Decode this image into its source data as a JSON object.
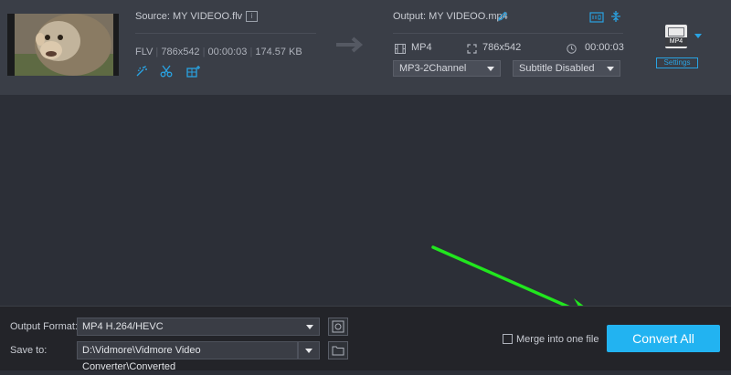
{
  "source": {
    "label": "Source: MY VIDEOO.flv",
    "format": "FLV",
    "resolution": "786x542",
    "duration": "00:00:03",
    "size": "174.57 KB",
    "info_icon": "i"
  },
  "output": {
    "label": "Output: MY VIDEOO.mp4",
    "format": "MP4",
    "resolution": "786x542",
    "duration": "00:00:03",
    "audio_select": "MP3-2Channel",
    "subtitle_select": "Subtitle Disabled",
    "profile_label": "MP4",
    "settings_label": "Settings"
  },
  "bottom": {
    "output_format_label": "Output Format:",
    "output_format_value": "MP4 H.264/HEVC",
    "save_to_label": "Save to:",
    "save_to_value": "D:\\Vidmore\\Vidmore Video Converter\\Converted",
    "merge_label": "Merge into one file",
    "convert_label": "Convert All"
  },
  "colors": {
    "accent": "#22b3f1",
    "arrow": "#21e61e",
    "background": "#2c2f37",
    "file_row": "#3a3e47"
  }
}
